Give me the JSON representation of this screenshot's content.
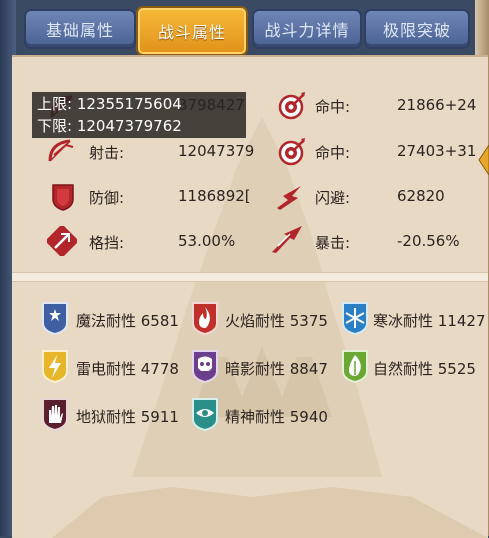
{
  "tabs": [
    {
      "label": "基础属性",
      "active": false
    },
    {
      "label": "战斗属性",
      "active": true
    },
    {
      "label": "战斗力详情",
      "active": false
    },
    {
      "label": "极限突破",
      "active": false
    }
  ],
  "tooltip": {
    "upper": "上限: 12355175604",
    "lower": "下限: 12047379762"
  },
  "combat_stats": {
    "left": [
      {
        "icon": "bow-icon",
        "label": "",
        "value": "3798427"
      },
      {
        "icon": "bow-icon",
        "label": "射击:",
        "value": "12047379"
      },
      {
        "icon": "shield-icon",
        "label": "防御:",
        "value": "1186892["
      },
      {
        "icon": "parry-icon",
        "label": "格挡:",
        "value": "53.00%"
      }
    ],
    "right": [
      {
        "icon": "target-icon",
        "label": "命中:",
        "value": "21866+24"
      },
      {
        "icon": "target-icon",
        "label": "命中:",
        "value": "27403+31"
      },
      {
        "icon": "dodge-icon",
        "label": "闪避:",
        "value": "62820"
      },
      {
        "icon": "crit-icon",
        "label": "暴击:",
        "value": "-20.56%"
      }
    ]
  },
  "resistances": [
    {
      "icon": "magic-star-icon",
      "label": "魔法耐性 6581",
      "color": "#3f5fa3"
    },
    {
      "icon": "flame-icon",
      "label": "火焰耐性 5375",
      "color": "#c0302a"
    },
    {
      "icon": "snowflake-icon",
      "label": "寒冰耐性 11427",
      "color": "#2b7fc4"
    },
    {
      "icon": "lightning-icon",
      "label": "雷电耐性 4778",
      "color": "#e7b62a"
    },
    {
      "icon": "demon-skull-icon",
      "label": "暗影耐性 8847",
      "color": "#6b3f8c"
    },
    {
      "icon": "leaf-flame-icon",
      "label": "自然耐性 5525",
      "color": "#6aa833"
    },
    {
      "icon": "hellfire-hand-icon",
      "label": "地狱耐性 5911",
      "color": "#5a1f2e"
    },
    {
      "icon": "spirit-eye-icon",
      "label": "精神耐性 5940",
      "color": "#2a8f88"
    }
  ]
}
